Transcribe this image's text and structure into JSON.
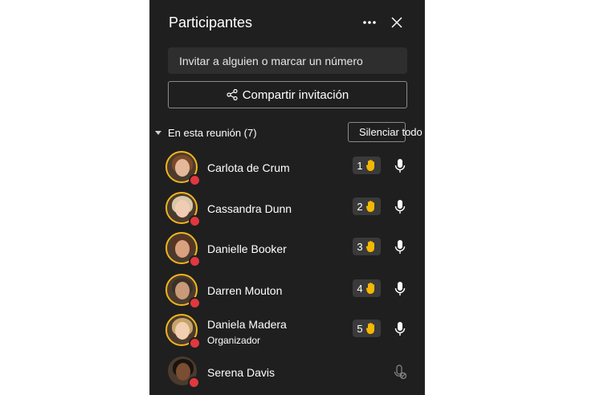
{
  "header": {
    "title": "Participantes",
    "more_icon": "more-icon",
    "close_icon": "close-icon"
  },
  "invite": {
    "placeholder": "Invitar a alguien o marcar un número"
  },
  "share": {
    "label": "Compartir invitación",
    "icon": "share-icon"
  },
  "section": {
    "label": "En esta reunión (7)",
    "mute_all_label": "Silenciar todo"
  },
  "participants": [
    {
      "name": "Carlota de Crum",
      "hand": "1",
      "hair": "#7a4a2a",
      "face": "#e5b89a"
    },
    {
      "name": "Cassandra Dunn",
      "hand": "2",
      "hair": "#d8c6a8",
      "face": "#f0cdb2"
    },
    {
      "name": "Danielle Booker",
      "hand": "3",
      "hair": "#5a3520",
      "face": "#d9a17f"
    },
    {
      "name": "Darren Mouton",
      "hand": "4",
      "hair": "#3a3028",
      "face": "#c89a7a"
    },
    {
      "name": "Daniela Madera",
      "role": "Organizador",
      "hand": "5",
      "hair": "#c7a36a",
      "face": "#f1cfb0"
    },
    {
      "name": "Serena Davis",
      "hair": "#1a1410",
      "face": "#7a4e32"
    }
  ],
  "colors": {
    "panel": "#1f1f1f",
    "ring": "#f2b51c",
    "status": "#e0383e",
    "hand": "#f5b800"
  }
}
